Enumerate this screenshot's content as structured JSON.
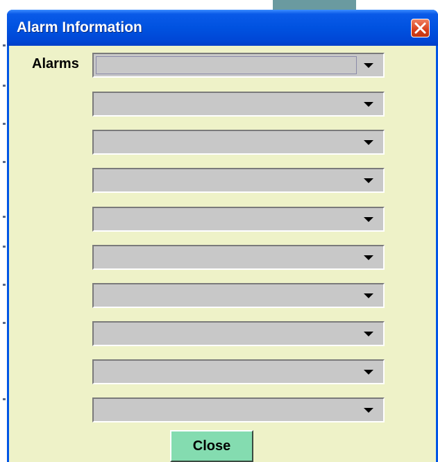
{
  "dialog": {
    "title": "Alarm Information",
    "close_icon": "close-x-icon",
    "alarms_label": "Alarms",
    "alarm_selects": [
      {
        "selected": ""
      },
      {
        "selected": ""
      },
      {
        "selected": ""
      },
      {
        "selected": ""
      },
      {
        "selected": ""
      },
      {
        "selected": ""
      },
      {
        "selected": ""
      },
      {
        "selected": ""
      },
      {
        "selected": ""
      },
      {
        "selected": ""
      }
    ],
    "close_button_label": "Close"
  },
  "background": {
    "partial_heading": "",
    "accent": "#ff0000"
  },
  "colors": {
    "titlebar": "#0055e5",
    "client_bg": "#eef2c8",
    "close_button_bg": "#84dcb0",
    "close_x_bg": "#d8401c"
  }
}
